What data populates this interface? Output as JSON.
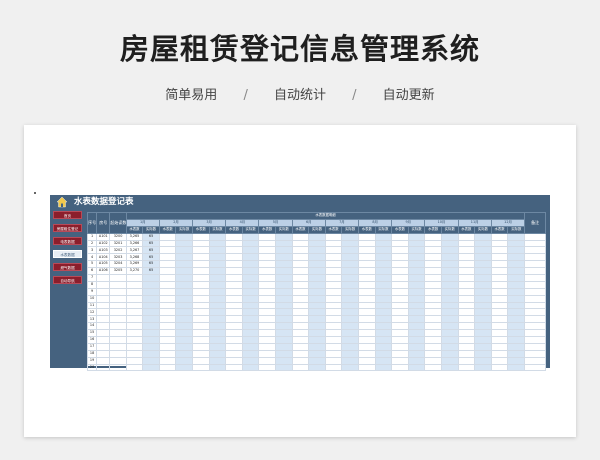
{
  "headline": "房屋租赁登记信息管理系统",
  "features": [
    "简单易用",
    "自动统计",
    "自动更新"
  ],
  "feature_separator": "/",
  "sheet": {
    "title": "水表数据登记表",
    "nav": [
      {
        "label": "首页",
        "active": false
      },
      {
        "label": "房屋租住登记",
        "active": false
      },
      {
        "label": "电表数据",
        "active": false
      },
      {
        "label": "水表数据",
        "active": true
      },
      {
        "label": "燃气数据",
        "active": false
      },
      {
        "label": "自动导航",
        "active": false
      }
    ],
    "table": {
      "col_headers": [
        "序号",
        "房号",
        "起始读数"
      ],
      "group_header": "水表数据明细",
      "months": [
        "1月",
        "2月",
        "3月",
        "4月",
        "5月",
        "6月",
        "7月",
        "8月",
        "9月",
        "10月",
        "11月",
        "12月"
      ],
      "sub_headers": [
        "水表数",
        "实际数"
      ],
      "remark_header": "备注",
      "rows": [
        {
          "no": "1",
          "room": "A101",
          "start": "3200",
          "m1_reading": "3,265",
          "m1_usage": "65"
        },
        {
          "no": "2",
          "room": "A102",
          "start": "3201",
          "m1_reading": "3,266",
          "m1_usage": "65"
        },
        {
          "no": "3",
          "room": "A103",
          "start": "3202",
          "m1_reading": "3,267",
          "m1_usage": "65"
        },
        {
          "no": "4",
          "room": "A104",
          "start": "3203",
          "m1_reading": "3,268",
          "m1_usage": "65"
        },
        {
          "no": "5",
          "room": "A105",
          "start": "3204",
          "m1_reading": "3,269",
          "m1_usage": "65"
        },
        {
          "no": "6",
          "room": "A106",
          "start": "3205",
          "m1_reading": "3,270",
          "m1_usage": "65"
        },
        {
          "no": "7"
        },
        {
          "no": "8"
        },
        {
          "no": "9"
        },
        {
          "no": "10"
        },
        {
          "no": "11"
        },
        {
          "no": "12"
        },
        {
          "no": "13"
        },
        {
          "no": "14"
        },
        {
          "no": "15"
        },
        {
          "no": "16"
        },
        {
          "no": "17"
        },
        {
          "no": "18"
        },
        {
          "no": "19"
        },
        {
          "no": "20"
        }
      ]
    }
  },
  "colors": {
    "sheet_bg": "#45627f",
    "nav_button": "#8b1e2c",
    "usage_column": "#d6e5f4",
    "month_header": "#bcd0e6"
  }
}
